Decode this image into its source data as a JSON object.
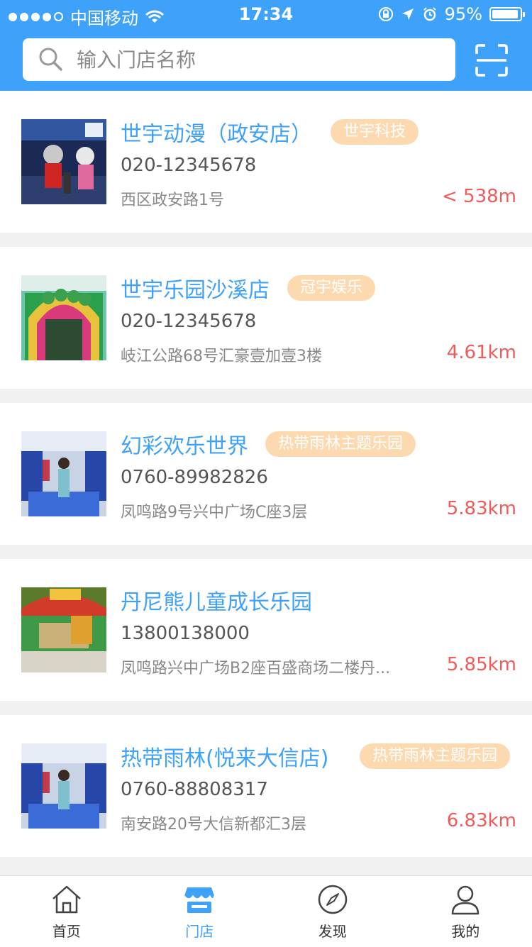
{
  "status_bar": {
    "carrier": "中国移动",
    "time": "17:34",
    "battery": "95%",
    "battery_level": 0.95
  },
  "search": {
    "placeholder": "输入门店名称"
  },
  "stores": [
    {
      "name": "世宇动漫（政安店）",
      "tag": "世宇科技",
      "phone": "020-12345678",
      "address": "西区政安路1号",
      "distance": "< 538m"
    },
    {
      "name": "世宇乐园沙溪店",
      "tag": "冠宇娱乐",
      "phone": "020-12345678",
      "address": "岐江公路68号汇豪壹加壹3楼",
      "distance": "4.61km"
    },
    {
      "name": "幻彩欢乐世界",
      "tag": "热带雨林主题乐园",
      "phone": "0760-89982826",
      "address": "凤鸣路9号兴中广场C座3层",
      "distance": "5.83km"
    },
    {
      "name": "丹尼熊儿童成长乐园",
      "tag": "",
      "phone": "13800138000",
      "address": "凤鸣路兴中广场B2座百盛商场二楼丹...",
      "distance": "5.85km"
    },
    {
      "name": "热带雨林(悦来大信店)",
      "tag": "热带雨林主题乐园",
      "phone": "0760-88808317",
      "address": "南安路20号大信新都汇3层",
      "distance": "6.83km"
    }
  ],
  "tabs": [
    {
      "label": "首页",
      "icon": "home-icon"
    },
    {
      "label": "门店",
      "icon": "store-icon",
      "active": true
    },
    {
      "label": "发现",
      "icon": "compass-icon"
    },
    {
      "label": "我的",
      "icon": "user-icon"
    }
  ],
  "colors": {
    "primary": "#3fa2fa",
    "tag_bg": "#fdd9b0",
    "distance": "#f25a5a"
  }
}
